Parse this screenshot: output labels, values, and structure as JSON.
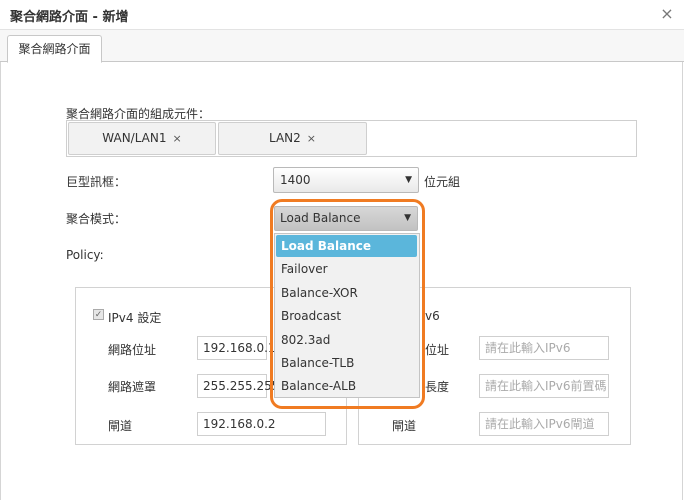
{
  "window": {
    "title": "聚合網路介面 - 新增",
    "close_glyph": "×"
  },
  "tabs": [
    {
      "label": "聚合網路介面"
    }
  ],
  "members": {
    "label": "聚合網路介面的組成元件：",
    "items": [
      {
        "label": "WAN/LAN1",
        "remove": "×"
      },
      {
        "label": "LAN2",
        "remove": "×"
      }
    ]
  },
  "jumbo": {
    "label": "巨型訊框：",
    "value": "1400",
    "unit": "位元組"
  },
  "mode": {
    "label": "聚合模式：",
    "value": "Load Balance",
    "options": [
      "Load Balance",
      "Failover",
      "Balance-XOR",
      "Broadcast",
      "802.3ad",
      "Balance-TLB",
      "Balance-ALB"
    ]
  },
  "policy": {
    "label": "Policy:"
  },
  "ipv4": {
    "legend": "IPv4 設定",
    "address_label": "網路位址",
    "address_value": "192.168.0.1",
    "mask_label": "網路遮罩",
    "mask_value": "255.255.255",
    "gateway_label": "閘道",
    "gateway_value": "192.168.0.2"
  },
  "ipv6": {
    "legend_visible": "v6",
    "address_label_visible": "位址",
    "address_placeholder": "請在此輸入IPv6",
    "prefix_label_visible": "長度",
    "prefix_placeholder": "請在此輸入IPv6前置碼",
    "gateway_label": "閘道",
    "gateway_placeholder": "請在此輸入IPv6閘道"
  },
  "colors": {
    "highlight": "#5bb6db",
    "annotation": "#f07b22"
  },
  "icons": {
    "dropdown": "chevron-down-icon",
    "checkbox": "checkmark-icon",
    "close": "close-icon"
  }
}
